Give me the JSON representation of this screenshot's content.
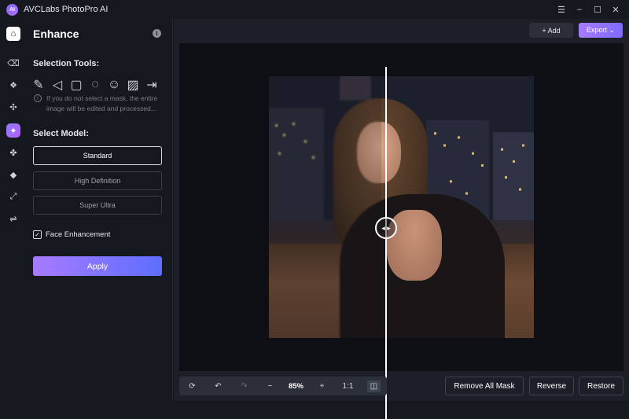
{
  "titlebar": {
    "logo_text": "AI",
    "title": "AVCLabs PhotoPro AI",
    "controls": [
      "☰",
      "–",
      "☐",
      "✕"
    ]
  },
  "rail": {
    "items": [
      {
        "name": "home-icon",
        "glyph": "⌂"
      },
      {
        "name": "eraser-icon",
        "glyph": "⌫"
      },
      {
        "name": "replace-icon",
        "glyph": "❖"
      },
      {
        "name": "expand-icon",
        "glyph": "✣"
      },
      {
        "name": "enhance-icon",
        "glyph": "✦"
      },
      {
        "name": "effects-icon",
        "glyph": "✤"
      },
      {
        "name": "colorize-icon",
        "glyph": "◆"
      },
      {
        "name": "upscale-icon",
        "glyph": "⤢"
      },
      {
        "name": "adjust-icon",
        "glyph": "⇌"
      }
    ]
  },
  "panel": {
    "title": "Enhance",
    "info_glyph": "i",
    "selection_tools_label": "Selection Tools:",
    "tools": [
      {
        "name": "brush-tool-icon",
        "glyph": "✎"
      },
      {
        "name": "lasso-tool-icon",
        "glyph": "◁"
      },
      {
        "name": "rectangle-tool-icon",
        "glyph": "▢"
      },
      {
        "name": "ellipse-tool-icon",
        "glyph": "◌"
      },
      {
        "name": "portrait-tool-icon",
        "glyph": "☺"
      },
      {
        "name": "auto-select-tool-icon",
        "glyph": "▨"
      },
      {
        "name": "import-mask-tool-icon",
        "glyph": "⇥"
      }
    ],
    "hint_glyph": "i",
    "hint": "If you do not select a mask, the entire image will be edited and processed...",
    "select_model_label": "Select Model:",
    "models": [
      "Standard",
      "High Definition",
      "Super Ultra"
    ],
    "selected_model": "Standard",
    "face_enhancement_label": "Face Enhancement",
    "face_enhancement_checked": true,
    "check_glyph": "✓",
    "apply_label": "Apply"
  },
  "top_actions": {
    "add_label": "+ Add",
    "export_label": "Export ⌄"
  },
  "compare": {
    "handle_glyph": "◂ ▸",
    "split_position": 0.44
  },
  "bottom_bar": {
    "reset_glyph": "⟳",
    "undo_glyph": "↶",
    "redo_glyph": "↷",
    "zoom_out_glyph": "−",
    "zoom_level": "85%",
    "zoom_in_glyph": "+",
    "actual_size_label": "1:1",
    "compare_glyph": "◫"
  },
  "actions": {
    "remove_all_mask": "Remove All Mask",
    "reverse": "Reverse",
    "restore": "Restore"
  },
  "colors": {
    "accent_start": "#a77bff",
    "accent_end": "#5d6eff",
    "background": "#15181f",
    "canvas": "#0d0f14"
  }
}
